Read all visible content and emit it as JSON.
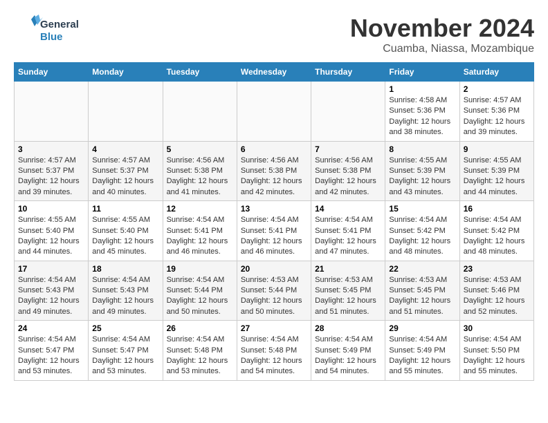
{
  "logo": {
    "general": "General",
    "blue": "Blue"
  },
  "title": "November 2024",
  "location": "Cuamba, Niassa, Mozambique",
  "headers": [
    "Sunday",
    "Monday",
    "Tuesday",
    "Wednesday",
    "Thursday",
    "Friday",
    "Saturday"
  ],
  "weeks": [
    [
      {
        "day": "",
        "sunrise": "",
        "sunset": "",
        "daylight": ""
      },
      {
        "day": "",
        "sunrise": "",
        "sunset": "",
        "daylight": ""
      },
      {
        "day": "",
        "sunrise": "",
        "sunset": "",
        "daylight": ""
      },
      {
        "day": "",
        "sunrise": "",
        "sunset": "",
        "daylight": ""
      },
      {
        "day": "",
        "sunrise": "",
        "sunset": "",
        "daylight": ""
      },
      {
        "day": "1",
        "sunrise": "Sunrise: 4:58 AM",
        "sunset": "Sunset: 5:36 PM",
        "daylight": "Daylight: 12 hours and 38 minutes."
      },
      {
        "day": "2",
        "sunrise": "Sunrise: 4:57 AM",
        "sunset": "Sunset: 5:36 PM",
        "daylight": "Daylight: 12 hours and 39 minutes."
      }
    ],
    [
      {
        "day": "3",
        "sunrise": "Sunrise: 4:57 AM",
        "sunset": "Sunset: 5:37 PM",
        "daylight": "Daylight: 12 hours and 39 minutes."
      },
      {
        "day": "4",
        "sunrise": "Sunrise: 4:57 AM",
        "sunset": "Sunset: 5:37 PM",
        "daylight": "Daylight: 12 hours and 40 minutes."
      },
      {
        "day": "5",
        "sunrise": "Sunrise: 4:56 AM",
        "sunset": "Sunset: 5:38 PM",
        "daylight": "Daylight: 12 hours and 41 minutes."
      },
      {
        "day": "6",
        "sunrise": "Sunrise: 4:56 AM",
        "sunset": "Sunset: 5:38 PM",
        "daylight": "Daylight: 12 hours and 42 minutes."
      },
      {
        "day": "7",
        "sunrise": "Sunrise: 4:56 AM",
        "sunset": "Sunset: 5:38 PM",
        "daylight": "Daylight: 12 hours and 42 minutes."
      },
      {
        "day": "8",
        "sunrise": "Sunrise: 4:55 AM",
        "sunset": "Sunset: 5:39 PM",
        "daylight": "Daylight: 12 hours and 43 minutes."
      },
      {
        "day": "9",
        "sunrise": "Sunrise: 4:55 AM",
        "sunset": "Sunset: 5:39 PM",
        "daylight": "Daylight: 12 hours and 44 minutes."
      }
    ],
    [
      {
        "day": "10",
        "sunrise": "Sunrise: 4:55 AM",
        "sunset": "Sunset: 5:40 PM",
        "daylight": "Daylight: 12 hours and 44 minutes."
      },
      {
        "day": "11",
        "sunrise": "Sunrise: 4:55 AM",
        "sunset": "Sunset: 5:40 PM",
        "daylight": "Daylight: 12 hours and 45 minutes."
      },
      {
        "day": "12",
        "sunrise": "Sunrise: 4:54 AM",
        "sunset": "Sunset: 5:41 PM",
        "daylight": "Daylight: 12 hours and 46 minutes."
      },
      {
        "day": "13",
        "sunrise": "Sunrise: 4:54 AM",
        "sunset": "Sunset: 5:41 PM",
        "daylight": "Daylight: 12 hours and 46 minutes."
      },
      {
        "day": "14",
        "sunrise": "Sunrise: 4:54 AM",
        "sunset": "Sunset: 5:41 PM",
        "daylight": "Daylight: 12 hours and 47 minutes."
      },
      {
        "day": "15",
        "sunrise": "Sunrise: 4:54 AM",
        "sunset": "Sunset: 5:42 PM",
        "daylight": "Daylight: 12 hours and 48 minutes."
      },
      {
        "day": "16",
        "sunrise": "Sunrise: 4:54 AM",
        "sunset": "Sunset: 5:42 PM",
        "daylight": "Daylight: 12 hours and 48 minutes."
      }
    ],
    [
      {
        "day": "17",
        "sunrise": "Sunrise: 4:54 AM",
        "sunset": "Sunset: 5:43 PM",
        "daylight": "Daylight: 12 hours and 49 minutes."
      },
      {
        "day": "18",
        "sunrise": "Sunrise: 4:54 AM",
        "sunset": "Sunset: 5:43 PM",
        "daylight": "Daylight: 12 hours and 49 minutes."
      },
      {
        "day": "19",
        "sunrise": "Sunrise: 4:54 AM",
        "sunset": "Sunset: 5:44 PM",
        "daylight": "Daylight: 12 hours and 50 minutes."
      },
      {
        "day": "20",
        "sunrise": "Sunrise: 4:53 AM",
        "sunset": "Sunset: 5:44 PM",
        "daylight": "Daylight: 12 hours and 50 minutes."
      },
      {
        "day": "21",
        "sunrise": "Sunrise: 4:53 AM",
        "sunset": "Sunset: 5:45 PM",
        "daylight": "Daylight: 12 hours and 51 minutes."
      },
      {
        "day": "22",
        "sunrise": "Sunrise: 4:53 AM",
        "sunset": "Sunset: 5:45 PM",
        "daylight": "Daylight: 12 hours and 51 minutes."
      },
      {
        "day": "23",
        "sunrise": "Sunrise: 4:53 AM",
        "sunset": "Sunset: 5:46 PM",
        "daylight": "Daylight: 12 hours and 52 minutes."
      }
    ],
    [
      {
        "day": "24",
        "sunrise": "Sunrise: 4:54 AM",
        "sunset": "Sunset: 5:47 PM",
        "daylight": "Daylight: 12 hours and 53 minutes."
      },
      {
        "day": "25",
        "sunrise": "Sunrise: 4:54 AM",
        "sunset": "Sunset: 5:47 PM",
        "daylight": "Daylight: 12 hours and 53 minutes."
      },
      {
        "day": "26",
        "sunrise": "Sunrise: 4:54 AM",
        "sunset": "Sunset: 5:48 PM",
        "daylight": "Daylight: 12 hours and 53 minutes."
      },
      {
        "day": "27",
        "sunrise": "Sunrise: 4:54 AM",
        "sunset": "Sunset: 5:48 PM",
        "daylight": "Daylight: 12 hours and 54 minutes."
      },
      {
        "day": "28",
        "sunrise": "Sunrise: 4:54 AM",
        "sunset": "Sunset: 5:49 PM",
        "daylight": "Daylight: 12 hours and 54 minutes."
      },
      {
        "day": "29",
        "sunrise": "Sunrise: 4:54 AM",
        "sunset": "Sunset: 5:49 PM",
        "daylight": "Daylight: 12 hours and 55 minutes."
      },
      {
        "day": "30",
        "sunrise": "Sunrise: 4:54 AM",
        "sunset": "Sunset: 5:50 PM",
        "daylight": "Daylight: 12 hours and 55 minutes."
      }
    ]
  ]
}
